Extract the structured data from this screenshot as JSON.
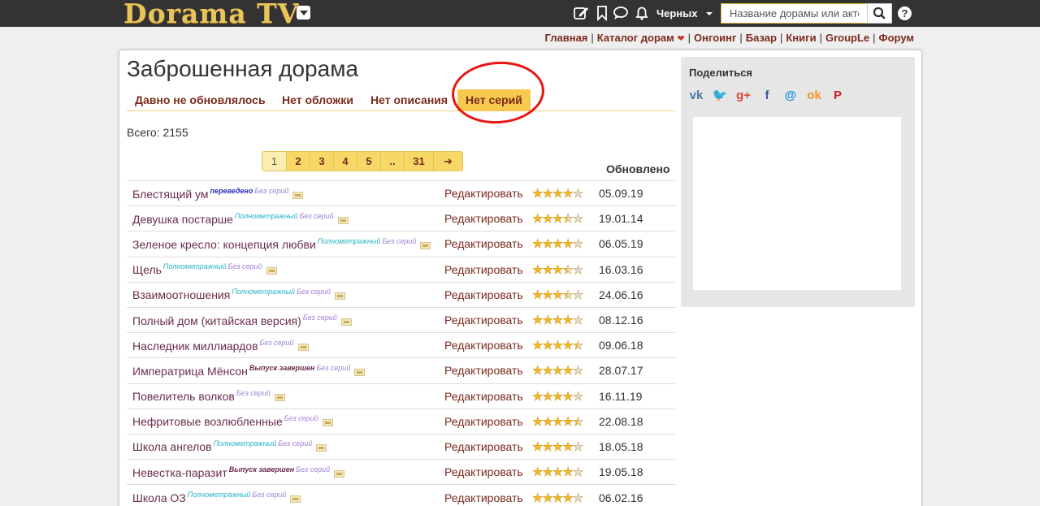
{
  "header": {
    "logo_text": "Dorama TV",
    "user_name": "Черных",
    "search_placeholder": "Название дорамы или актера",
    "help_label": "?"
  },
  "nav": {
    "links": [
      "Главная",
      "Каталог дорам",
      "Онгоинг",
      "Базар",
      "Книги",
      "GroupLe",
      "Форум"
    ],
    "separator": "|"
  },
  "main": {
    "title": "Заброшенная дорама",
    "tabs": [
      {
        "label": "Давно не обновлялось",
        "active": false
      },
      {
        "label": "Нет обложки",
        "active": false
      },
      {
        "label": "Нет описания",
        "active": false
      },
      {
        "label": "Нет серий",
        "active": true
      }
    ],
    "total_label": "Всего: 2155",
    "pagination": [
      "1",
      "2",
      "3",
      "4",
      "5",
      "..",
      "31",
      "➜"
    ],
    "column_updated": "Обновлено",
    "edit_label": "Редактировать",
    "rows": [
      {
        "title": "Блестящий ум",
        "badges": [
          {
            "text": "переведено",
            "kind": "trans"
          },
          {
            "text": "Без серий",
            "kind": "noeps"
          }
        ],
        "rating": 0.8,
        "date": "05.09.19"
      },
      {
        "title": "Девушка постарше",
        "badges": [
          {
            "text": "Полнометражный",
            "kind": "full"
          },
          {
            "text": "Без серий",
            "kind": "noeps"
          }
        ],
        "rating": 0.7,
        "date": "19.01.14"
      },
      {
        "title": "Зеленое кресло: концепция любви",
        "badges": [
          {
            "text": "Полнометражный",
            "kind": "full"
          },
          {
            "text": "Без серий",
            "kind": "noeps"
          }
        ],
        "rating": 0.8,
        "date": "06.05.19"
      },
      {
        "title": "Щель",
        "badges": [
          {
            "text": "Полнометражный",
            "kind": "full"
          },
          {
            "text": "Без серий",
            "kind": "noeps"
          }
        ],
        "rating": 0.7,
        "date": "16.03.16"
      },
      {
        "title": "Взаимоотношения",
        "badges": [
          {
            "text": "Полнометражный",
            "kind": "full"
          },
          {
            "text": "Без серий",
            "kind": "noeps"
          }
        ],
        "rating": 0.7,
        "date": "24.06.16"
      },
      {
        "title": "Полный дом (китайская версия)",
        "badges": [
          {
            "text": "Без серий",
            "kind": "noeps"
          }
        ],
        "rating": 0.8,
        "date": "08.12.16"
      },
      {
        "title": "Наследник миллиардов",
        "badges": [
          {
            "text": "Без серий",
            "kind": "noeps"
          }
        ],
        "rating": 0.9,
        "date": "09.06.18"
      },
      {
        "title": "Императрица Мёнсон",
        "badges": [
          {
            "text": "Выпуск завершен",
            "kind": "done"
          },
          {
            "text": "Без серий",
            "kind": "noeps"
          }
        ],
        "rating": 0.8,
        "date": "28.07.17"
      },
      {
        "title": "Повелитель волков",
        "badges": [
          {
            "text": "Без серий",
            "kind": "noeps"
          }
        ],
        "rating": 0.8,
        "date": "16.11.19"
      },
      {
        "title": "Нефритовые возлюбленные",
        "badges": [
          {
            "text": "Без серий",
            "kind": "noeps"
          }
        ],
        "rating": 0.9,
        "date": "22.08.18"
      },
      {
        "title": "Школа ангелов",
        "badges": [
          {
            "text": "Полнометражный",
            "kind": "full"
          },
          {
            "text": "Без серий",
            "kind": "noeps"
          }
        ],
        "rating": 0.8,
        "date": "18.05.18"
      },
      {
        "title": "Невестка-паразит",
        "badges": [
          {
            "text": "Выпуск завершен",
            "kind": "done"
          },
          {
            "text": "Без серий",
            "kind": "noeps"
          }
        ],
        "rating": 0.8,
        "date": "19.05.18"
      },
      {
        "title": "Школа ОЗ",
        "badges": [
          {
            "text": "Полнометражный",
            "kind": "full"
          },
          {
            "text": "Без серий",
            "kind": "noeps"
          }
        ],
        "rating": 0.8,
        "date": "06.02.16"
      }
    ]
  },
  "sidebar": {
    "share_title": "Поделиться",
    "share_icons": [
      {
        "icon": "vk-icon",
        "glyph": "vk",
        "color": "#4a76a8"
      },
      {
        "icon": "twitter-icon",
        "glyph": "🐦",
        "color": "#1da1f2"
      },
      {
        "icon": "google-plus-icon",
        "glyph": "g+",
        "color": "#dd4b39"
      },
      {
        "icon": "facebook-icon",
        "glyph": "f",
        "color": "#3b5998"
      },
      {
        "icon": "mail-icon",
        "glyph": "@",
        "color": "#168de2"
      },
      {
        "icon": "odnoklassniki-icon",
        "glyph": "ok",
        "color": "#f7931e"
      },
      {
        "icon": "pinterest-icon",
        "glyph": "P",
        "color": "#cb2027"
      }
    ]
  },
  "colors": {
    "accent": "#f7c94e",
    "link": "#7a2a1c",
    "topbar": "#333333",
    "annotation_circle": "#e8140f"
  }
}
